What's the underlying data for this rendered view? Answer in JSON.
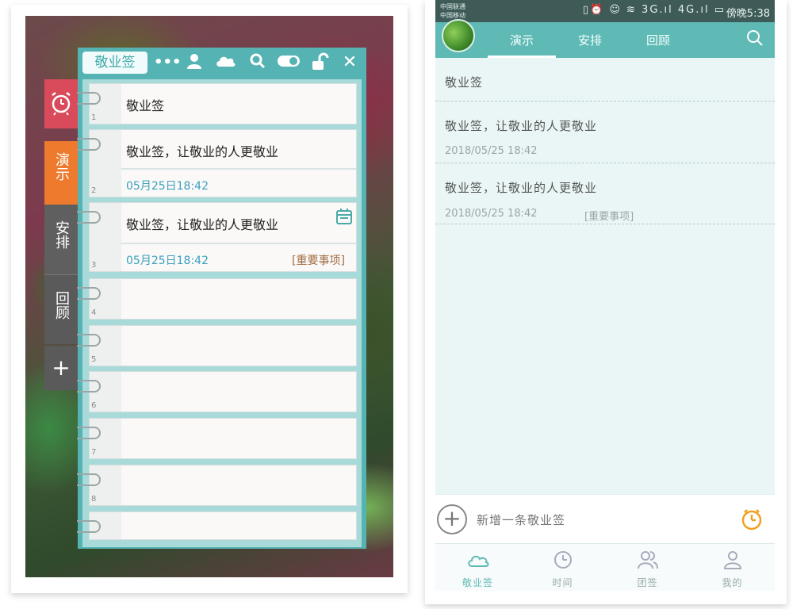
{
  "desktop_widget": {
    "title": "敬业签",
    "side_tabs": {
      "demo": "演示",
      "arrange": "安排",
      "review": "回顾",
      "add": "+"
    },
    "notes": [
      {
        "num": "1",
        "text": "敬业签",
        "date": "",
        "tag": ""
      },
      {
        "num": "2",
        "text": "敬业签，让敬业的人更敬业",
        "date": "05月25日18:42",
        "tag": ""
      },
      {
        "num": "3",
        "text": "敬业签，让敬业的人更敬业",
        "date": "05月25日18:42",
        "tag": "[重要事项]"
      },
      {
        "num": "4"
      },
      {
        "num": "5"
      },
      {
        "num": "6"
      },
      {
        "num": "7"
      },
      {
        "num": "8"
      },
      {
        "num": ""
      }
    ]
  },
  "phone": {
    "status": {
      "carrier1": "中国联通",
      "carrier2": "中国移动",
      "icons": "▯⏰ ☺ ≋ 3G.ıl 4G.ıl ▭",
      "time": "傍晚5:38"
    },
    "tabs": {
      "demo": "演示",
      "arrange": "安排",
      "review": "回顾"
    },
    "rows": [
      {
        "text": "敬业签",
        "date": "",
        "tag": ""
      },
      {
        "text": "敬业签，让敬业的人更敬业",
        "date": "2018/05/25 18:42",
        "tag": ""
      },
      {
        "text": "敬业签，让敬业的人更敬业",
        "date": "2018/05/25 18:42",
        "tag": "[重要事项]"
      }
    ],
    "composer": {
      "placeholder": "新增一条敬业签"
    },
    "bottom_nav": {
      "notes": "敬业签",
      "time": "时间",
      "team": "团签",
      "mine": "我的"
    },
    "colors": {
      "accent": "#5fb9b4",
      "orange": "#f0a020"
    }
  }
}
